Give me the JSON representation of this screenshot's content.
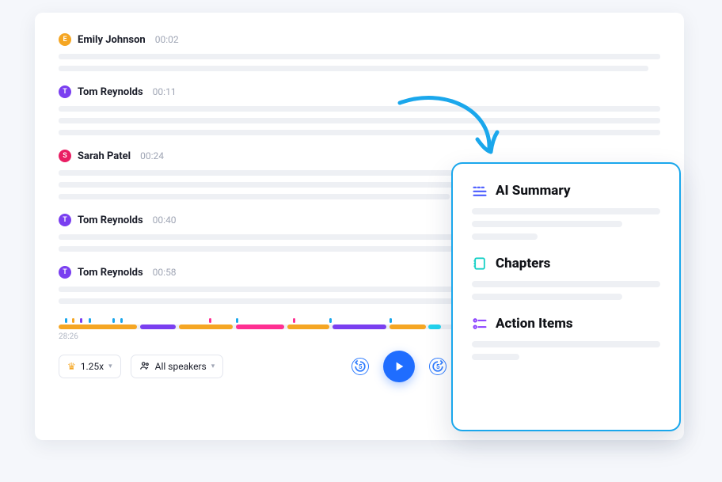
{
  "transcript": {
    "blocks": [
      {
        "initial": "E",
        "avatar": "orange",
        "name": "Emily Johnson",
        "time": "00:02"
      },
      {
        "initial": "T",
        "avatar": "purple",
        "name": "Tom Reynolds",
        "time": "00:11"
      },
      {
        "initial": "S",
        "avatar": "pink",
        "name": "Sarah Patel",
        "time": "00:24"
      },
      {
        "initial": "T",
        "avatar": "purple",
        "name": "Tom Reynolds",
        "time": "00:40"
      },
      {
        "initial": "T",
        "avatar": "purple",
        "name": "Tom Reynolds",
        "time": "00:58"
      }
    ]
  },
  "player": {
    "duration": "28:26",
    "speed_label": "1.25x",
    "speakers_label": "All speakers",
    "skip_seconds": "5"
  },
  "summary": {
    "sections": [
      {
        "title": "AI Summary"
      },
      {
        "title": "Chapters"
      },
      {
        "title": "Action Items"
      }
    ]
  }
}
